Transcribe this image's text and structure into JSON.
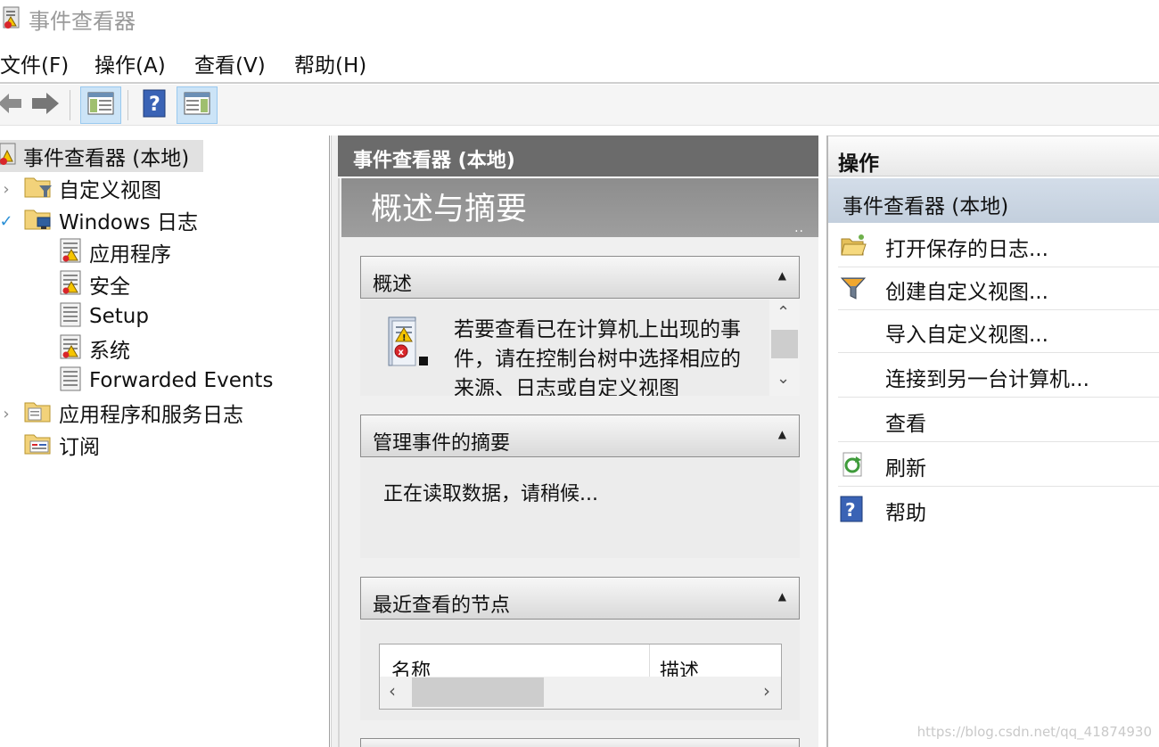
{
  "window": {
    "title": "事件查看器"
  },
  "menu": [
    "文件(F)",
    "操作(A)",
    "查看(V)",
    "帮助(H)"
  ],
  "toolbar": {
    "back": "back-arrow-icon",
    "forward": "forward-arrow-icon",
    "show_hide_tree": "console-tree-icon",
    "help": "help-icon",
    "show_hide_actions": "action-pane-icon"
  },
  "tree": {
    "root": "事件查看器 (本地)",
    "custom_views": "自定义视图",
    "windows_logs": "Windows 日志",
    "application": "应用程序",
    "security": "安全",
    "setup": "Setup",
    "system": "系统",
    "forwarded": "Forwarded Events",
    "app_service_logs": "应用程序和服务日志",
    "subscriptions": "订阅"
  },
  "center": {
    "header": "事件查看器 (本地)",
    "banner_title": "概述与摘要",
    "banner_dots": "..",
    "overview": {
      "title": "概述",
      "text": "若要查看已在计算机上出现的事件，请在控制台树中选择相应的来源、日志或自定义视图"
    },
    "summary": {
      "title": "管理事件的摘要",
      "text": "正在读取数据，请稍候..."
    },
    "recent": {
      "title": "最近查看的节点",
      "col_name": "名称",
      "col_desc": "描述"
    }
  },
  "actions": {
    "header": "操作",
    "group": "事件查看器 (本地)",
    "items": [
      {
        "label": "打开保存的日志...",
        "icon": "open-folder-icon"
      },
      {
        "label": "创建自定义视图...",
        "icon": "filter-icon"
      },
      {
        "label": "导入自定义视图...",
        "icon": ""
      },
      {
        "label": "连接到另一台计算机...",
        "icon": ""
      },
      {
        "label": "查看",
        "icon": ""
      },
      {
        "label": "刷新",
        "icon": "refresh-icon"
      },
      {
        "label": "帮助",
        "icon": "help-icon"
      }
    ]
  },
  "watermark": "https://blog.csdn.net/qq_41874930",
  "colors": {
    "center_header": "#6b6b6b",
    "banner": "#9a9a9a",
    "actions_group": "#c9d4e1",
    "selected_tree": "#e1e1e1"
  }
}
